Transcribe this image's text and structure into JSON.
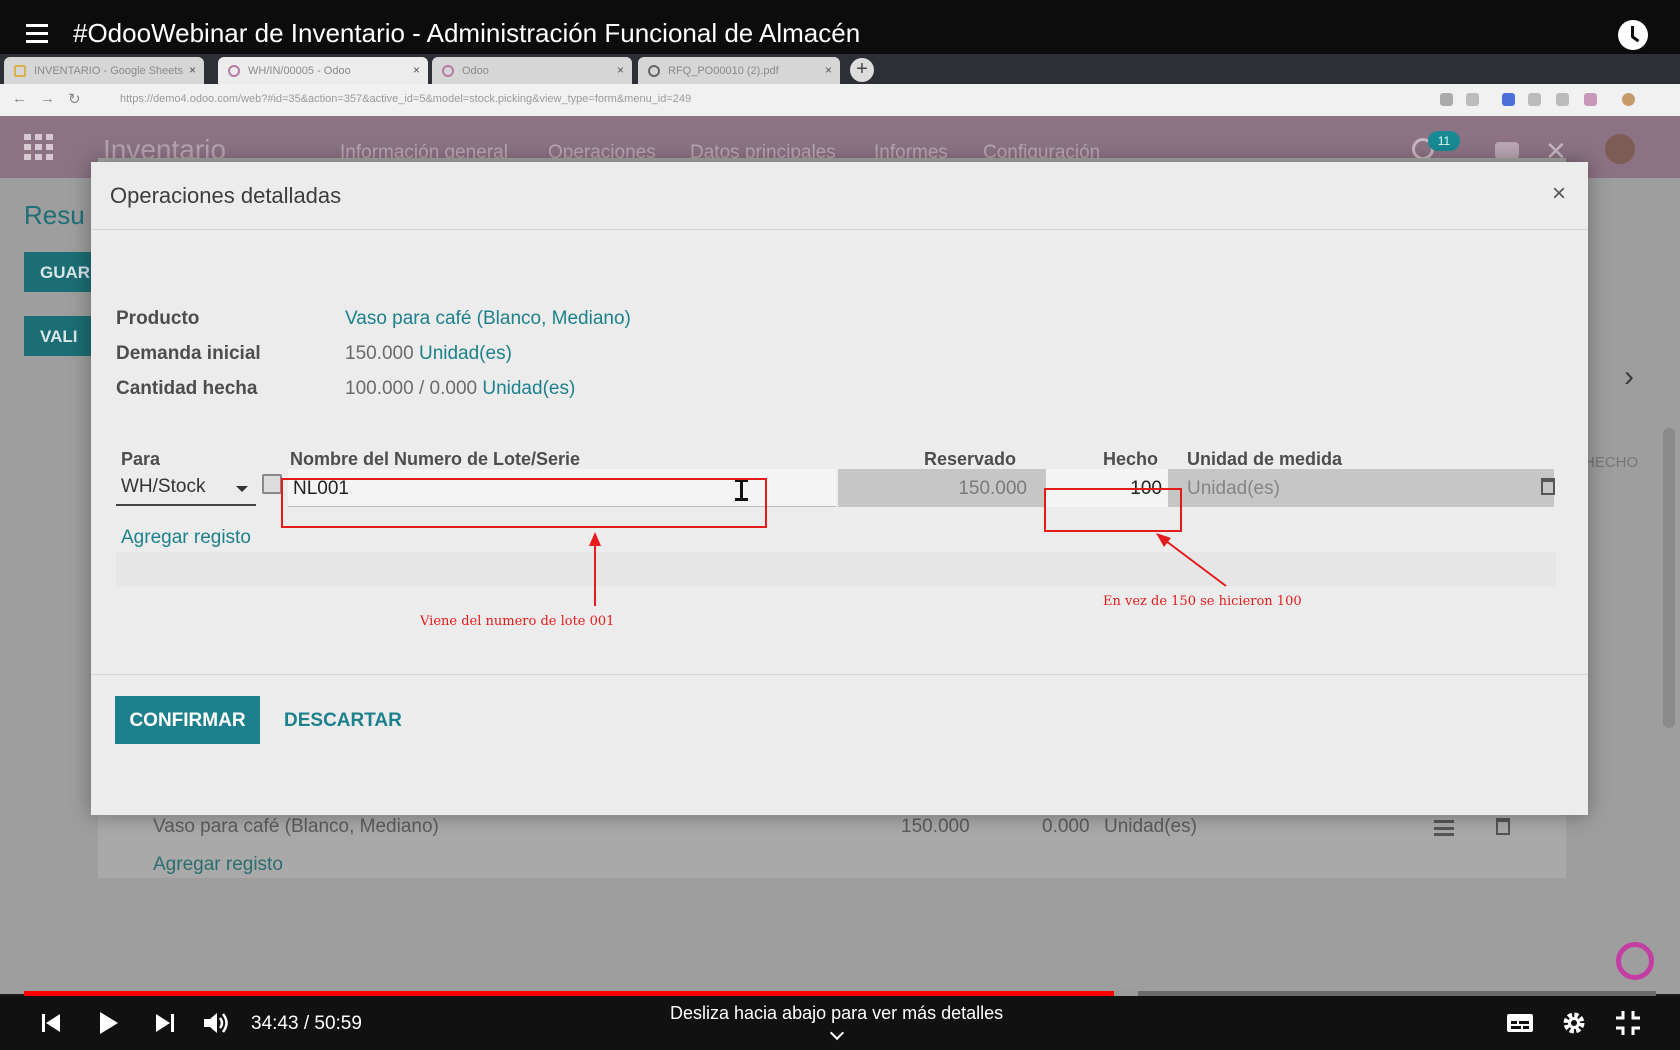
{
  "video_title": "#OdooWebinar de Inventario - Administración Funcional de Almacén",
  "browser": {
    "tabs": [
      {
        "label": "INVENTARIO - Google Sheets"
      },
      {
        "label": "WH/IN/00005 - Odoo"
      },
      {
        "label": "Odoo"
      },
      {
        "label": "RFQ_PO00010 (2).pdf"
      }
    ],
    "url": "https://demo4.odoo.com/web?#id=35&action=357&active_id=5&model=stock.picking&view_type=form&menu_id=249"
  },
  "odoo": {
    "app_name": "Inventario",
    "menu": [
      "Información general",
      "Operaciones",
      "Datos principales",
      "Informes",
      "Configuración"
    ],
    "activity_count": "11"
  },
  "background": {
    "title": "Resu",
    "save_button": "GUAR",
    "validate_button": "VALI",
    "hecho_col": "HECHO",
    "row_product": "Vaso para café (Blanco, Mediano)",
    "row_demand": "150.000",
    "row_done": "0.000",
    "row_unit": "Unidad(es)",
    "add_line": "Agregar registo"
  },
  "modal": {
    "title": "Operaciones detalladas",
    "close": "×",
    "product_label": "Producto",
    "product_value": "Vaso para café (Blanco, Mediano)",
    "demand_label": "Demanda inicial",
    "demand_value": "150.000",
    "demand_unit": "Unidad(es)",
    "done_label": "Cantidad hecha",
    "done_value": "100.000",
    "done_sep": "/",
    "done_reserved": "0.000",
    "done_unit": "Unidad(es)",
    "columns": {
      "para": "Para",
      "lot": "Nombre del Numero de Lote/Serie",
      "reserved": "Reservado",
      "done": "Hecho",
      "uom": "Unidad de medida"
    },
    "row": {
      "para": "WH/Stock",
      "lot": "NL001",
      "reserved": "150.000",
      "done": "100",
      "uom": "Unidad(es)"
    },
    "add_line": "Agregar registo",
    "confirm_button": "CONFIRMAR",
    "discard_button": "DESCARTAR"
  },
  "annotations": {
    "lot_note": "Viene del numero de lote 001",
    "done_note": "En vez de 150 se hicieron 100"
  },
  "player": {
    "time": "34:43 / 50:59",
    "progress_played": 0.6676,
    "progress_loaded": 0.6823,
    "hint": "Desliza hacia abajo para ver más detalles"
  }
}
